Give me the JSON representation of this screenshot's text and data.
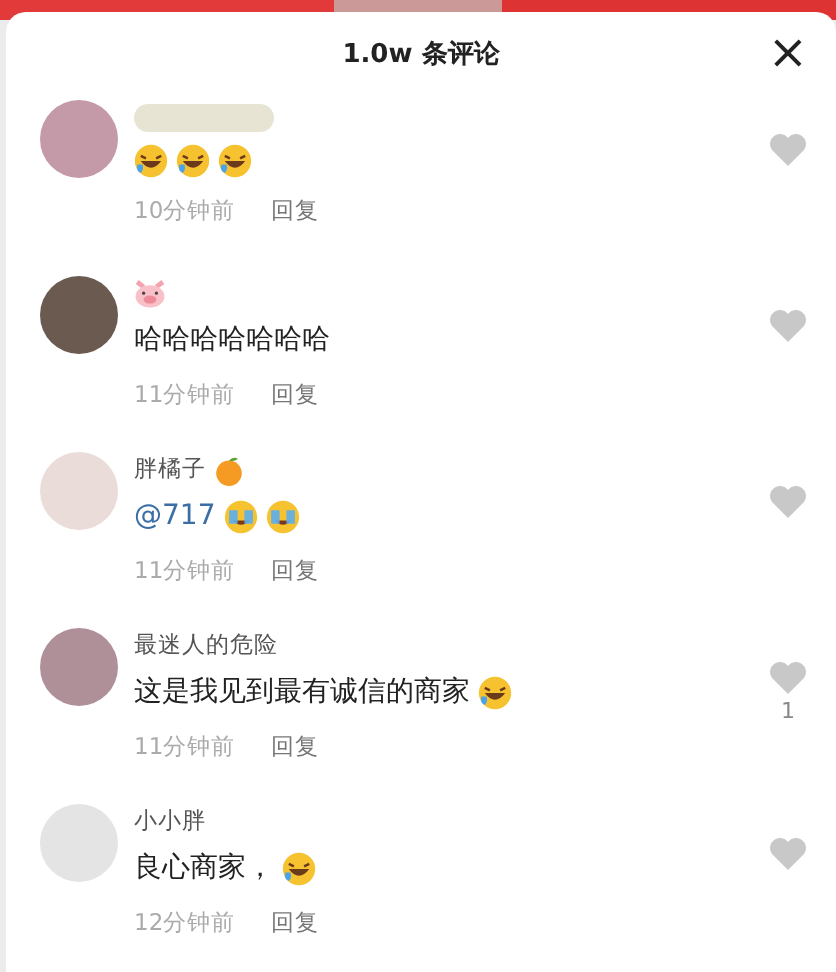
{
  "header": {
    "title": "1.0w 条评论",
    "close": "×"
  },
  "comments": [
    {
      "name_blurred": true,
      "emojis": [
        {
          "kind": "laugh"
        },
        {
          "kind": "laugh"
        },
        {
          "kind": "laugh"
        }
      ],
      "time": "10分钟前",
      "reply": "回复",
      "color": "#c49aa8"
    },
    {
      "name_emojis": [
        {
          "kind": "pig"
        }
      ],
      "text": "哈哈哈哈哈哈哈",
      "time": "11分钟前",
      "reply": "回复",
      "color": "#6b5a50"
    },
    {
      "name": "胖橘子",
      "name_emojis": [
        {
          "kind": "fruit"
        }
      ],
      "text": "@717",
      "mention": true,
      "emojis": [
        {
          "kind": "cry"
        },
        {
          "kind": "cry"
        }
      ],
      "time": "11分钟前",
      "reply": "回复",
      "color": "#eadcd8"
    },
    {
      "name": "最迷人的危险",
      "text": "这是我见到最有诚信的商家",
      "emojis": [
        {
          "kind": "laugh"
        }
      ],
      "time": "11分钟前",
      "reply": "回复",
      "color": "#b09098",
      "like_count": "1"
    },
    {
      "name": "小小胖",
      "text": "良心商家，",
      "emojis": [
        {
          "kind": "laugh"
        }
      ],
      "time": "12分钟前",
      "reply": "回复",
      "color": "#e4e4e4"
    }
  ]
}
